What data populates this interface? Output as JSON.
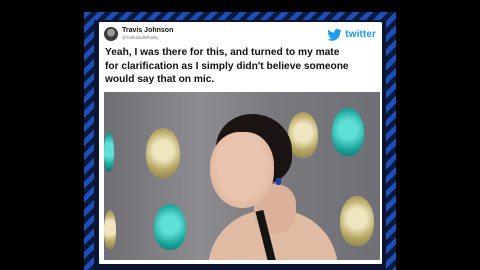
{
  "tweet": {
    "author_name": "Travis Johnson",
    "author_handle": "@CelluloidWhisky",
    "brand_label": "twitter",
    "text_lines": [
      "Yeah, I was there for this, and turned to my mate",
      "for clarification as I simply didn't believe someone",
      "would say that on mic."
    ]
  },
  "icons": {
    "brand": "twitter-bird-icon",
    "avatar": "avatar-image"
  },
  "colors": {
    "brand_blue": "#1d9bf0",
    "frame_blue": "#1d4fb8",
    "background": "#000000"
  }
}
